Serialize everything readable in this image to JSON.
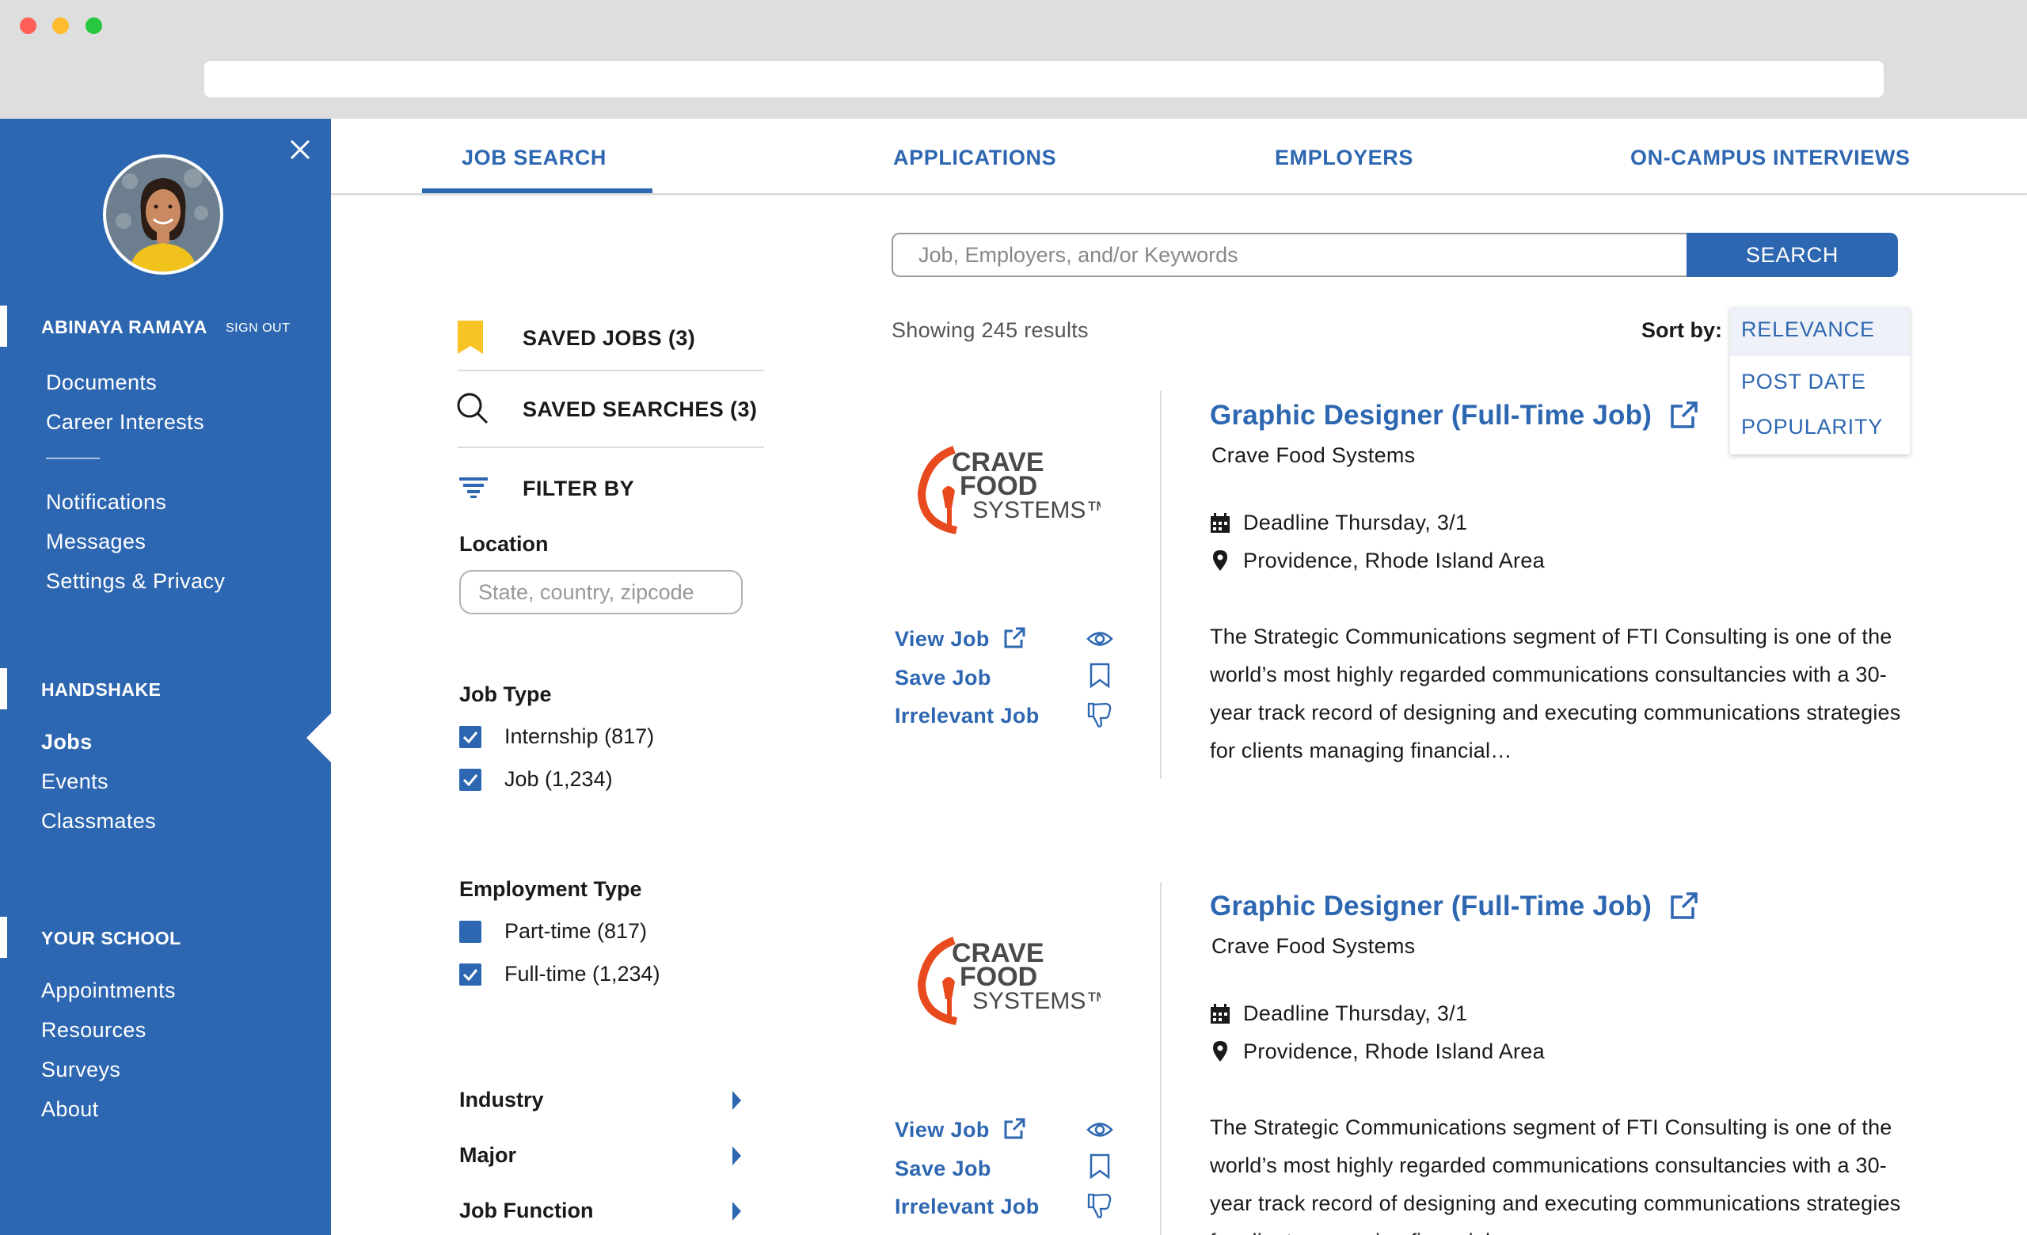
{
  "sidebar": {
    "user_name": "ABINAYA RAMAYA",
    "sign_out": "SIGN OUT",
    "account_links": [
      "Documents",
      "Career Interests"
    ],
    "settings_links": [
      "Notifications",
      "Messages",
      "Settings & Privacy"
    ],
    "handshake_heading": "HANDSHAKE",
    "handshake_links": [
      "Jobs",
      "Events",
      "Classmates"
    ],
    "school_heading": "YOUR SCHOOL",
    "school_links": [
      "Appointments",
      "Resources",
      "Surveys",
      "About"
    ],
    "accent_color": "#2e67b1"
  },
  "tabs": [
    "JOB SEARCH",
    "APPLICATIONS",
    "EMPLOYERS",
    "ON-CAMPUS INTERVIEWS"
  ],
  "search": {
    "placeholder": "Job, Employers, and/or Keywords",
    "button": "SEARCH"
  },
  "results": {
    "count_text": "Showing 245 results",
    "sort_label": "Sort by:",
    "sort_options": [
      "RELEVANCE",
      "POST DATE",
      "POPULARITY"
    ],
    "sort_selected": "RELEVANCE"
  },
  "filters": {
    "saved_jobs": "SAVED JOBS (3)",
    "saved_searches": "SAVED SEARCHES (3)",
    "filter_by": "FILTER BY",
    "location_label": "Location",
    "location_placeholder": "State, country, zipcode",
    "job_type_label": "Job Type",
    "job_type_options": [
      {
        "label": "Internship (817)",
        "checked": true
      },
      {
        "label": "Job (1,234)",
        "checked": true
      }
    ],
    "employment_type_label": "Employment Type",
    "employment_type_options": [
      {
        "label": "Part-time (817)",
        "checked": false
      },
      {
        "label": "Full-time (1,234)",
        "checked": true
      }
    ],
    "collapsed": [
      "Industry",
      "Major",
      "Job Function"
    ]
  },
  "jobs": [
    {
      "title": "Graphic Designer (Full-Time Job)",
      "company": "Crave Food Systems",
      "deadline": "Deadline Thursday, 3/1",
      "location": "Providence, Rhode Island Area",
      "description": "The Strategic Communications segment of FTI Consulting is one of the world’s most highly regarded communications consultancies with a 30-year track record of designing and executing communications strategies for clients managing financial…",
      "actions": [
        "View Job",
        "Save Job",
        "Irrelevant Job"
      ],
      "logo_text": [
        "CRAVE",
        "FOOD",
        "SYSTEMS™"
      ]
    },
    {
      "title": "Graphic Designer (Full-Time Job)",
      "company": "Crave Food Systems",
      "deadline": "Deadline Thursday, 3/1",
      "location": "Providence, Rhode Island Area",
      "description": "The Strategic Communications segment of FTI Consulting is one of the world’s most highly regarded communications consultancies with a 30-year track record of designing and executing communications strategies for clients managing financial…",
      "actions": [
        "View Job",
        "Save Job",
        "Irrelevant Job"
      ],
      "logo_text": [
        "CRAVE",
        "FOOD",
        "SYSTEMS™"
      ]
    }
  ]
}
